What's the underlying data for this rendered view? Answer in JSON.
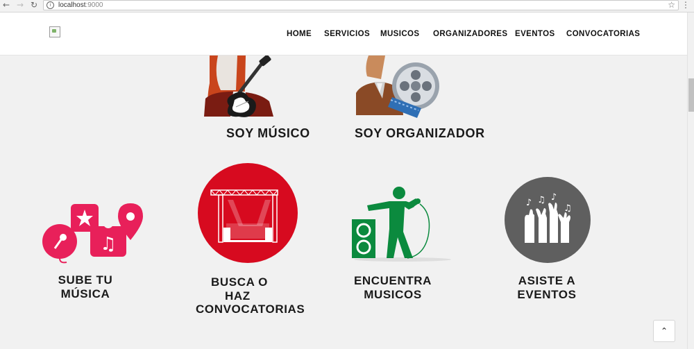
{
  "browser": {
    "url_host": "localhost",
    "url_port": ":9000"
  },
  "header": {
    "nav": [
      "HOME",
      "SERVICIOS",
      "MUSICOS",
      "ORGANIZADORES",
      "EVENTOS",
      "CONVOCATORIAS"
    ]
  },
  "profiles": {
    "musician": "SOY MÚSICO",
    "organizer": "SOY ORGANIZADOR"
  },
  "features": {
    "upload": [
      "SUBE TU",
      "MÚSICA"
    ],
    "calls": [
      "BUSCA O",
      "HAZ",
      "CONVOCATORIAS"
    ],
    "musicians": [
      "ENCUENTRA",
      "MUSICOS"
    ],
    "events": [
      "ASISTE A",
      "EVENTOS"
    ]
  },
  "colors": {
    "red": "#d70a1f",
    "pink": "#e8205a",
    "green": "#0b8a3e",
    "gray": "#5f5f5f"
  }
}
